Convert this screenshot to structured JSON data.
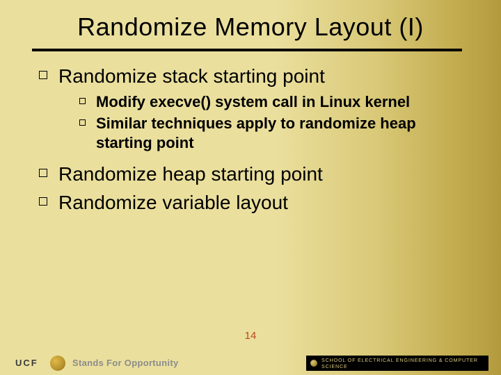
{
  "title": "Randomize Memory Layout (I)",
  "bullets": {
    "b1": "Randomize stack starting point",
    "b1_sub1": "Modify execve() system call in Linux kernel",
    "b1_sub2": "Similar techniques apply to randomize heap starting point",
    "b2": "Randomize heap starting point",
    "b3": "Randomize variable layout"
  },
  "page_number": "14",
  "footer": {
    "ucf": "UCF",
    "tagline": "Stands For Opportunity",
    "department": "SCHOOL OF ELECTRICAL ENGINEERING & COMPUTER SCIENCE"
  }
}
